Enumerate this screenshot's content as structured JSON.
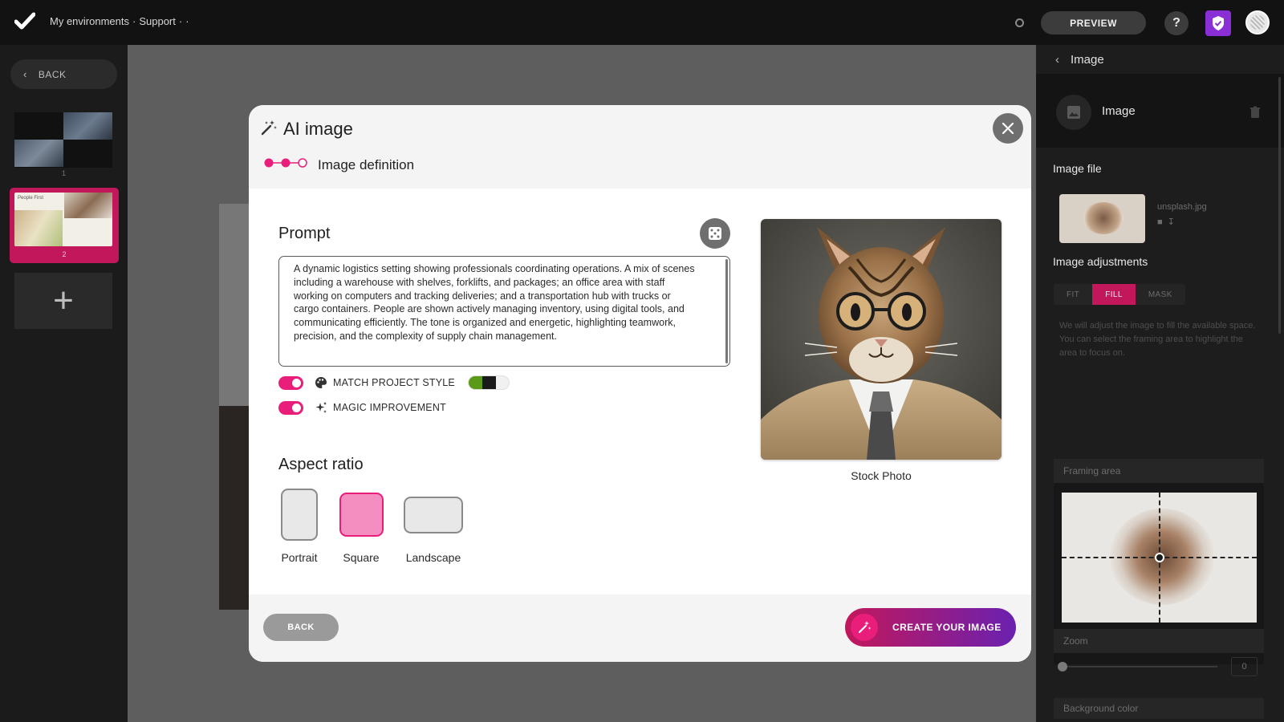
{
  "header": {
    "breadcrumb": [
      "My environments",
      "·",
      "Support",
      "·",
      "·"
    ],
    "preview_label": "PREVIEW",
    "help_label": "?"
  },
  "left_panel": {
    "back_label": "BACK",
    "slides": [
      {
        "number": "1"
      },
      {
        "number": "2",
        "title": "People First"
      }
    ],
    "add_label": "+"
  },
  "right_panel": {
    "header_title": "Image",
    "element_label": "Image",
    "image_file_title": "Image file",
    "file_name": "unsplash.jpg",
    "adjustments_title": "Image adjustments",
    "adjust_modes": [
      "FIT",
      "FILL",
      "MASK"
    ],
    "active_mode": "FILL",
    "description": "We will adjust the image to fill the available space. You can select the framing area to highlight the area to focus on.",
    "framing_label": "Framing area",
    "zoom_label": "Zoom",
    "zoom_value": "0",
    "background_label": "Background color"
  },
  "modal": {
    "title": "AI image",
    "step_label": "Image definition",
    "steps_total": 3,
    "steps_done": 2,
    "prompt_title": "Prompt",
    "prompt_text": "A dynamic logistics setting showing professionals coordinating operations. A mix of scenes including a warehouse with shelves, forklifts, and packages; an office area with staff working on computers and tracking deliveries; and a transportation hub with trucks or cargo containers. People are shown actively managing inventory, using digital tools, and communicating efficiently. The tone is organized and energetic, highlighting teamwork, precision, and the complexity of supply chain management.",
    "option_match_style": "MATCH PROJECT STYLE",
    "option_magic": "MAGIC IMPROVEMENT",
    "match_style_enabled": true,
    "magic_enabled": true,
    "aspect_title": "Aspect ratio",
    "aspects": [
      "Portrait",
      "Square",
      "Landscape"
    ],
    "selected_aspect": "Square",
    "preview_caption": "Stock Photo",
    "back_label": "BACK",
    "create_label": "CREATE YOUR IMAGE"
  },
  "colors": {
    "accent": "#e91e7b",
    "accent_dark": "#c2185b",
    "gradient_end": "#6a21b0",
    "badge": "#8a2fd6"
  }
}
